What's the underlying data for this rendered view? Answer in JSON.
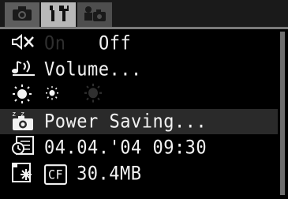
{
  "tabs": [
    {
      "icon": "camera-icon",
      "active": false
    },
    {
      "icon": "tools-icon",
      "active": true
    },
    {
      "icon": "my-camera-icon",
      "active": false
    }
  ],
  "menu": {
    "mute": {
      "icon": "speaker-muted-icon",
      "on_label": "On",
      "off_label": "Off",
      "selected": "Off"
    },
    "volume": {
      "icon": "volume-icon",
      "label": "Volume..."
    },
    "lcd_brightness": {
      "icon": "brightness-icon",
      "options": [
        "sun-small-icon",
        "sun-large-icon"
      ],
      "selected_index": 0
    },
    "power_saving": {
      "icon": "power-saving-icon",
      "label": "Power Saving..."
    },
    "date_time": {
      "icon": "clock-icon",
      "value": "04.04.'04 09:30"
    },
    "format": {
      "icon": "format-card-icon",
      "card_label": "CF",
      "value": "30.4MB"
    }
  },
  "colors": {
    "text": "#f2f2f2",
    "dim_text": "#2f2f2f",
    "active_tab": "#b8b8b8",
    "band": "#2a2a2a"
  }
}
